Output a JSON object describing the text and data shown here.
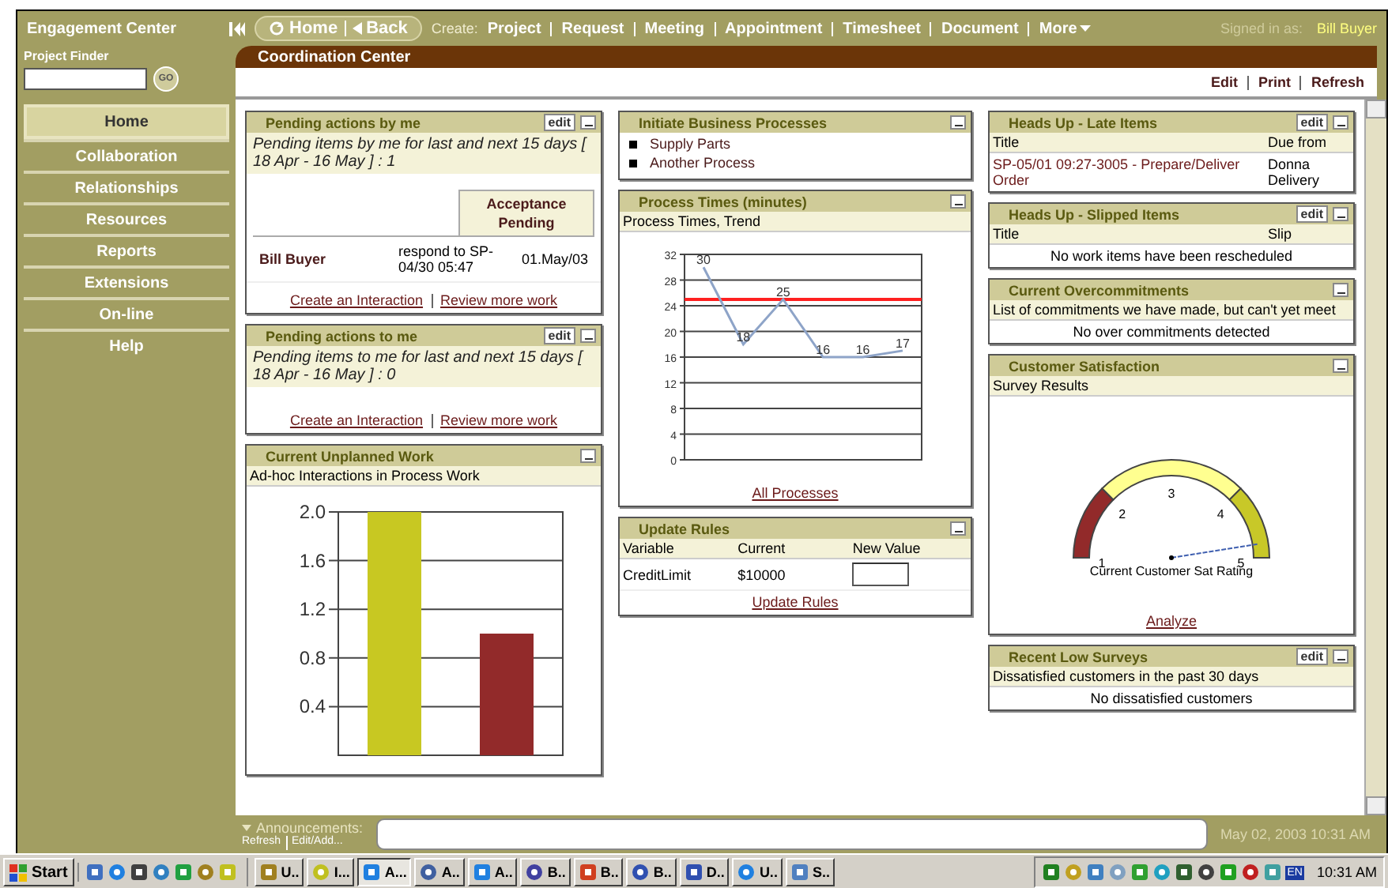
{
  "top_bar": {
    "app_title": "Engagement Center",
    "home": "Home",
    "back": "Back",
    "create_label": "Create:",
    "create_links": [
      "Project",
      "Request",
      "Meeting",
      "Appointment",
      "Timesheet",
      "Document",
      "More"
    ],
    "signed_in_label": "Signed in as:",
    "user": "Bill Buyer"
  },
  "sidebar": {
    "finder_label": "Project Finder",
    "go": "GO",
    "items": [
      {
        "label": "Home",
        "selected": true
      },
      {
        "label": "Collaboration",
        "selected": false
      },
      {
        "label": "Relationships",
        "selected": false
      },
      {
        "label": "Resources",
        "selected": false
      },
      {
        "label": "Reports",
        "selected": false
      },
      {
        "label": "Extensions",
        "selected": false
      },
      {
        "label": "On-line",
        "selected": false
      },
      {
        "label": "Help",
        "selected": false
      }
    ]
  },
  "page": {
    "title": "Coordination Center",
    "actions": [
      "Edit",
      "Print",
      "Refresh"
    ]
  },
  "columns": [
    [
      {
        "kind": "pending",
        "title": "Pending actions by me",
        "edit": "edit",
        "summary": "Pending items by me for last and next 15 days  [ 18 Apr - 16 May ] : 1",
        "table_header": "Acceptance Pending",
        "rows": [
          {
            "name": "Bill Buyer",
            "task": "respond to SP-04/30 05:47",
            "date": "01.May/03"
          }
        ],
        "links": [
          "Create an Interaction",
          "Review more work"
        ]
      },
      {
        "kind": "pending",
        "title": "Pending actions to me",
        "edit": "edit",
        "summary": "Pending items to me for last and next 15 days [ 18 Apr - 16 May ] : 0",
        "links": [
          "Create an Interaction",
          "Review more work"
        ]
      },
      {
        "kind": "bar_chart",
        "title": "Current Unplanned Work",
        "subtitle": "Ad-hoc Interactions in Process Work",
        "chart_data": {
          "type": "bar",
          "grid": true,
          "ylim": [
            0,
            2
          ],
          "yticks": [
            0.4,
            0.8,
            1.2,
            1.6,
            {
              "value": 2,
              "label": "2.0"
            }
          ],
          "series": [
            {
              "color": "#c8c822",
              "values": [
                2.0,
                null
              ]
            },
            {
              "color": "#922a2a",
              "values": [
                null,
                1.0
              ]
            }
          ]
        }
      }
    ],
    [
      {
        "kind": "list",
        "title": "Initiate Business Processes",
        "items": [
          "Supply Parts",
          "Another Process"
        ]
      },
      {
        "kind": "line_chart",
        "title": "Process Times (minutes)",
        "subtitle": "Process Times, Trend",
        "chart_data": {
          "type": "line",
          "grid": true,
          "ylim": [
            0,
            32
          ],
          "yticks": [
            0,
            4,
            8,
            12,
            16,
            20,
            24,
            28,
            32
          ],
          "series": [
            {
              "color": "#8ea4c8",
              "values": [
                30,
                18,
                25,
                16,
                16,
                17
              ]
            }
          ],
          "data_labels": true,
          "ref_lines": [
            {
              "axis": "y",
              "value": 25,
              "color": "#ff2020"
            }
          ]
        },
        "links": [
          "All Processes"
        ]
      },
      {
        "kind": "rules",
        "title": "Update Rules",
        "headers": [
          "Variable",
          "Current",
          "New Value"
        ],
        "rows": [
          {
            "variable": "CreditLimit",
            "current": "$10000"
          }
        ],
        "links": [
          "Update Rules"
        ]
      }
    ],
    [
      {
        "kind": "table",
        "title": "Heads Up - Late Items",
        "edit": "edit",
        "headers": [
          "Title",
          "Due from"
        ],
        "rows": [
          [
            "SP-05/01 09:27-3005 - Prepare/Deliver Order",
            "Donna Delivery"
          ]
        ]
      },
      {
        "kind": "table",
        "title": "Heads Up - Slipped Items",
        "edit": "edit",
        "headers": [
          "Title",
          "Slip"
        ],
        "empty": "No work items have been rescheduled"
      },
      {
        "kind": "table",
        "title": "Current Overcommitments",
        "subtitle": "List of commitments we have made, but can't yet meet",
        "empty": "No over commitments detected"
      },
      {
        "kind": "gauge",
        "title": "Customer Satisfaction",
        "subtitle": "Survey Results",
        "gauge": {
          "labels": [
            "1",
            "2",
            "3",
            "4",
            "5"
          ],
          "caption": "Current Customer Sat Rating"
        },
        "links": [
          "Analyze"
        ]
      },
      {
        "kind": "table",
        "title": "Recent Low Surveys",
        "edit": "edit",
        "subtitle": "Dissatisfied customers in the past 30 days",
        "empty": "No dissatisfied customers"
      }
    ]
  ],
  "announcements": {
    "label": "Announcements:",
    "links": [
      "Refresh",
      "Edit/Add..."
    ],
    "timestamp": "May 02, 2003 10:31 AM"
  },
  "taskbar": {
    "start": "Start",
    "tasks": [
      {
        "label": "U..",
        "selected": false
      },
      {
        "label": "I...",
        "selected": false
      },
      {
        "label": "A...",
        "selected": true
      },
      {
        "label": "A..",
        "selected": false
      },
      {
        "label": "A..",
        "selected": false
      },
      {
        "label": "B..",
        "selected": false
      },
      {
        "label": "B..",
        "selected": false
      },
      {
        "label": "B..",
        "selected": false
      },
      {
        "label": "D..",
        "selected": false
      },
      {
        "label": "U..",
        "selected": false
      },
      {
        "label": "S..",
        "selected": false
      }
    ],
    "language": "EN",
    "clock": "10:31 AM"
  }
}
